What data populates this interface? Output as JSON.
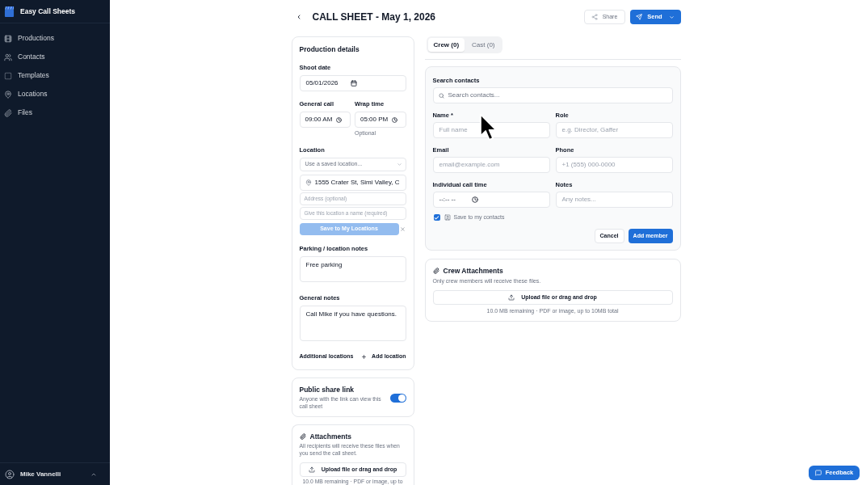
{
  "sidebar": {
    "brand": "Easy Call Sheets",
    "items": [
      {
        "label": "Productions",
        "selected": false
      },
      {
        "label": "Contacts",
        "selected": false
      },
      {
        "label": "Templates",
        "selected": false
      },
      {
        "label": "Locations",
        "selected": false
      },
      {
        "label": "Files",
        "selected": false
      }
    ],
    "user": {
      "name": "Mike Vannelli"
    }
  },
  "header": {
    "title": "CALL SHEET - May 1, 2026",
    "share_button": "Share",
    "send_button": "Send"
  },
  "production_details": {
    "title": "Production details",
    "shoot_date": {
      "label": "Shoot date",
      "value": "05/01/2026"
    },
    "general_call": {
      "label": "General call",
      "value": "09:00 AM"
    },
    "wrap_time": {
      "label": "Wrap time",
      "value": "05:00 PM",
      "hint": "Optional"
    },
    "location": {
      "label": "Location",
      "saved_select": {
        "placeholder": "Use a saved location..."
      },
      "address_search": {
        "value": "1555 Crater St, Simi Valley, C"
      },
      "address_field": {
        "placeholder": "Address (optional)"
      },
      "name_field": {
        "placeholder": "Give this location a name (required)"
      },
      "save_button": {
        "label": "Save to My Locations",
        "disabled": true
      }
    },
    "parking_notes": {
      "label": "Parking / location notes",
      "value": "Free parking"
    },
    "general_notes": {
      "label": "General notes",
      "value": "Call Mike if you have questions."
    },
    "additional_locations": {
      "label": "Additional locations",
      "button": "Add location"
    }
  },
  "public_share_link": {
    "title": "Public share link",
    "description": "Anyone with the link can view this call sheet",
    "on": true
  },
  "attachments": {
    "title": "Attachments",
    "description": "All recipients will receive these files when you send the call sheet.",
    "upload_button": "Upload file or drag and drop",
    "note": "10.0 MB remaining · PDF or image, up to"
  },
  "tabs": [
    {
      "label": "Crew (0)",
      "selected": true
    },
    {
      "label": "Cast (0)",
      "selected": false
    }
  ],
  "member_form": {
    "search": {
      "label": "Search contacts",
      "placeholder": "Search contacts..."
    },
    "fields": [
      {
        "kind": "text",
        "label": "Name *",
        "placeholder": "Full name"
      },
      {
        "kind": "text",
        "label": "Role",
        "placeholder": "e.g. Director, Gaffer"
      },
      {
        "kind": "text",
        "label": "Email",
        "placeholder": "email@example.com"
      },
      {
        "kind": "text",
        "label": "Phone",
        "placeholder": "+1 (555) 000-0000"
      },
      {
        "kind": "time",
        "label": "Individual call time",
        "value": "--:-- --"
      },
      {
        "kind": "text",
        "label": "Notes",
        "placeholder": "Any notes..."
      }
    ],
    "save_to_contacts": {
      "label": "Save to my contacts",
      "checked": true
    },
    "cancel_button": "Cancel",
    "add_button": "Add member"
  },
  "crew_attachments": {
    "title": "Crew Attachments",
    "description": "Only crew members will receive these files.",
    "upload_button": "Upload file or drag and drop",
    "note": "10.0 MB remaining · PDF or image, up to 10MB total"
  },
  "feedback_button": "Feedback"
}
